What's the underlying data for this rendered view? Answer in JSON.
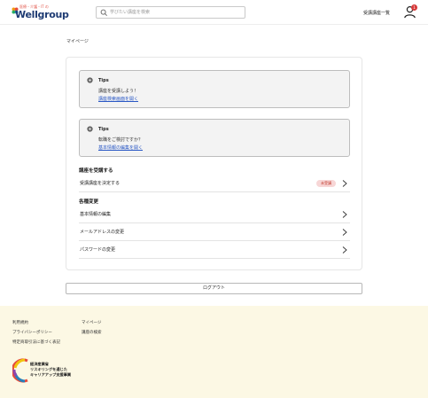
{
  "header": {
    "logo_tagline": "医療・介護・IT の",
    "logo_text": "Wellgroup",
    "search_placeholder": "学びたい講座を検索",
    "course_list_label": "受講講座一覧",
    "notification_count": "1"
  },
  "breadcrumb": "マイページ",
  "tips": [
    {
      "title": "Tips",
      "text": "講座を受講しよう！",
      "link": "講座検索画面を開く"
    },
    {
      "title": "Tips",
      "text": "転職をご検討ですか？",
      "link": "基本情報の編集を開く"
    }
  ],
  "course_section": {
    "title": "講座を受講する",
    "row_label": "受講講座を決定する",
    "status": "未受講"
  },
  "settings_section": {
    "title": "各種変更",
    "rows": [
      "基本情報の編集",
      "メールアドレスの変更",
      "パスワードの変更"
    ]
  },
  "logout_label": "ログアウト",
  "footer": {
    "links_col1": [
      "利用規約",
      "プライバシーポリシー",
      "特定商取引法に基づく表記"
    ],
    "links_col2": [
      "マイページ",
      "講座の検索"
    ],
    "meti_lines": [
      "経済産業省",
      "リスキリングを通じた",
      "キャリアアップ支援事業"
    ]
  },
  "colors": {
    "brand_navy": "#1e3b73",
    "link_blue": "#2a58c5",
    "badge_red": "#d63a3a",
    "footer_bg": "#fcf8e4"
  },
  "icons": [
    "leaf-logo-icon",
    "search-icon",
    "user-icon",
    "info-icon",
    "chevron-right-icon",
    "meti-ring-icon"
  ]
}
